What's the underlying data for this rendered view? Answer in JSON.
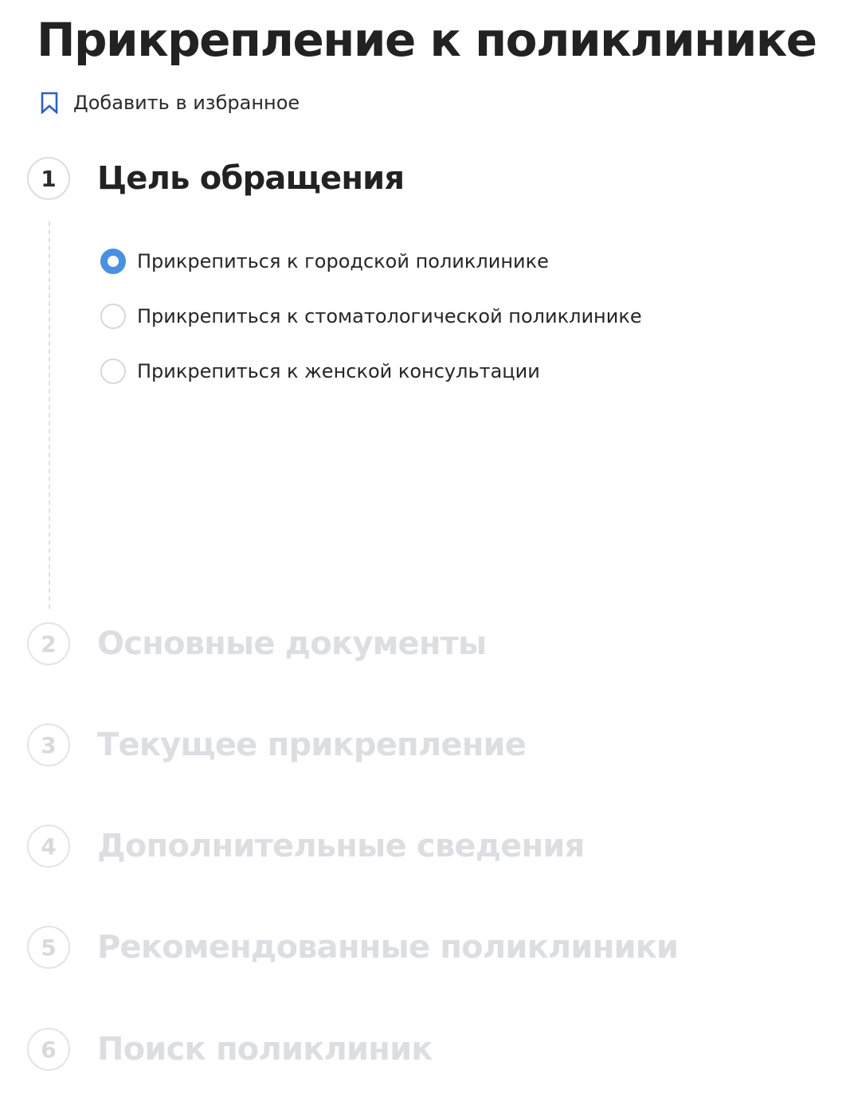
{
  "page": {
    "title": "Прикрепление к поликлинике"
  },
  "favorite": {
    "label": "Добавить в избранное",
    "icon": "bookmark-icon",
    "icon_color": "#2f5fc4"
  },
  "steps": [
    {
      "number": "1",
      "title": "Цель обращения",
      "state": "active"
    },
    {
      "number": "2",
      "title": "Основные документы",
      "state": "inactive"
    },
    {
      "number": "3",
      "title": "Текущее прикрепление",
      "state": "inactive"
    },
    {
      "number": "4",
      "title": "Дополнительные сведения",
      "state": "inactive"
    },
    {
      "number": "5",
      "title": "Рекомендованные поликлиники",
      "state": "inactive"
    },
    {
      "number": "6",
      "title": "Поиск поликлиник",
      "state": "inactive"
    }
  ],
  "purpose_options": [
    {
      "label": "Прикрепиться к городской поликлинике",
      "selected": true
    },
    {
      "label": "Прикрепиться к стоматологической поликлинике",
      "selected": false
    },
    {
      "label": "Прикрепиться к женской консультации",
      "selected": false
    }
  ],
  "colors": {
    "accent": "#4a90e2",
    "inactive_text": "#dcdee2",
    "text": "#222222"
  }
}
